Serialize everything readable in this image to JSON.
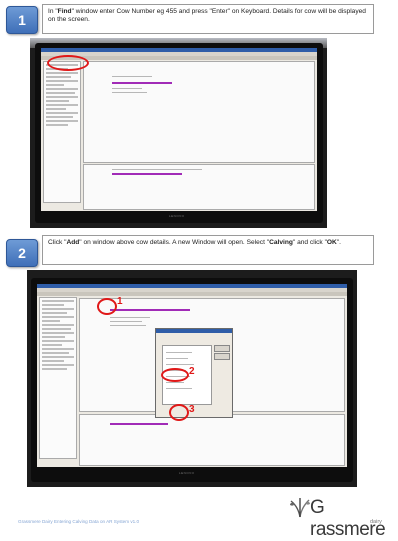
{
  "steps": [
    {
      "number": "1",
      "text_parts": [
        "In \"",
        "Find",
        "\" window enter Cow Number eg 455 and press \"Enter\" on Keyboard. Details for cow will be displayed on the screen."
      ],
      "monitor_brand": "LENOVO"
    },
    {
      "number": "2",
      "text_parts": [
        "Click \"",
        "Add",
        "\" on window above cow details. A new Window will open. Select \"",
        "Calving",
        "\" and click \"",
        "OK",
        "\"."
      ],
      "monitor_brand": "LENOVO",
      "markers": [
        "1",
        "2",
        "3"
      ]
    }
  ],
  "footer": {
    "caption": "Grassmere Dairy Entering Calving Data on AR System v1.0",
    "logo_text": "G rassmere",
    "logo_subtext": "dairy"
  },
  "colors": {
    "step_badge": "#4a7cc2",
    "marker": "#e01818",
    "highlight": "#a12bb7",
    "footer_text": "#86a6d4"
  }
}
